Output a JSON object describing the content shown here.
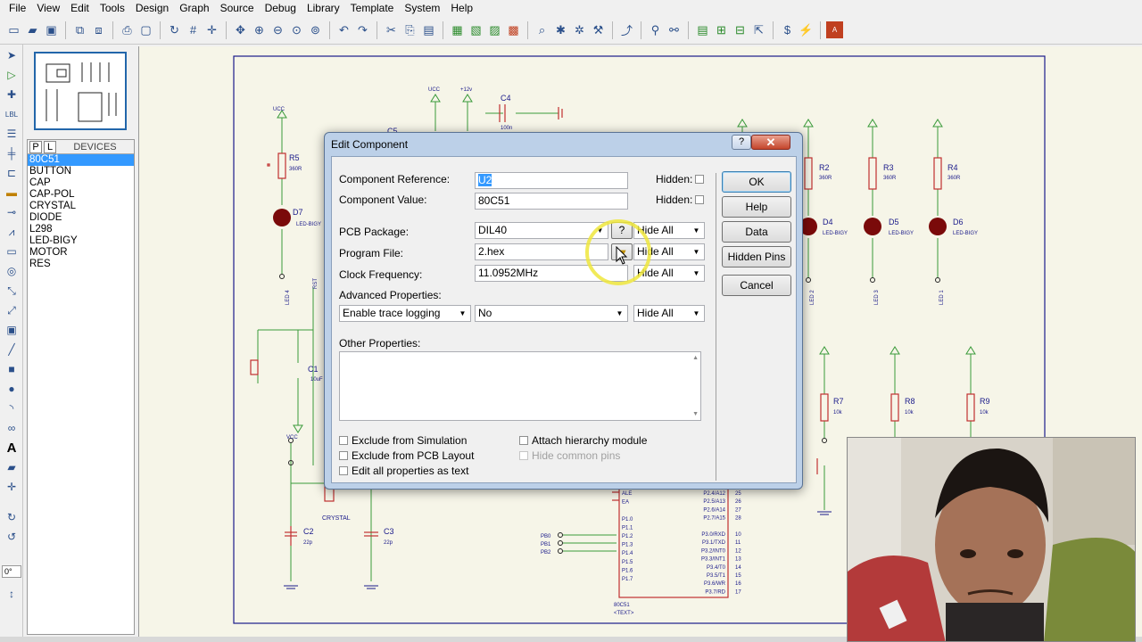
{
  "menu": [
    "File",
    "View",
    "Edit",
    "Tools",
    "Design",
    "Graph",
    "Source",
    "Debug",
    "Library",
    "Template",
    "System",
    "Help"
  ],
  "device_panel": {
    "tab_p": "P",
    "tab_l": "L",
    "title": "DEVICES",
    "items": [
      "80C51",
      "BUTTON",
      "CAP",
      "CAP-POL",
      "CRYSTAL",
      "DIODE",
      "L298",
      "LED-BIGY",
      "MOTOR",
      "RES"
    ],
    "selected": "80C51"
  },
  "rotation": "0°",
  "schematic": {
    "labels": {
      "r5": "R5",
      "r5v": "360R",
      "d7": "D7",
      "d7p": "LED-BIGY",
      "led4": "LED 4",
      "rst": "RST",
      "vcc": "VCC",
      "c1": "C1",
      "c1v": "10uF",
      "c2": "C2",
      "c2v": "22p",
      "c3": "C3",
      "c3v": "22p",
      "crystal": "CRYSTAL",
      "c4": "C4",
      "c4v": "100n",
      "c5": "C5",
      "v12": "+12v",
      "r2": "R2",
      "r3": "R3",
      "r4": "R4",
      "rv": "360R",
      "d4": "D4",
      "d5": "D5",
      "d6": "D6",
      "ledp": "LED-BIGY",
      "led2": "LED 2",
      "led3": "LED 3",
      "led1": "LED 1",
      "r7": "R7",
      "r8": "R8",
      "r9": "R9",
      "rk": "10k",
      "pb0": "PB0",
      "pb1": "PB1",
      "pb2": "PB2",
      "u2": "80C51",
      "text": "<TEXT>",
      "ucc": "UCC",
      "pins_left": [
        "ALE",
        "EA",
        "",
        "P1.0",
        "P1.1",
        "P1.2",
        "P1.3",
        "P1.4",
        "P1.5",
        "P1.6",
        "P1.7"
      ],
      "pins_right": [
        "P2.4/A12",
        "P2.5/A13",
        "P2.6/A14",
        "P2.7/A15",
        "",
        "P3.0/RXD",
        "P3.1/TXD",
        "P3.2/INT0",
        "P3.3/INT1",
        "P3.4/T0",
        "P3.5/T1",
        "P3.6/WR",
        "P3.7/RD"
      ],
      "pin_nums_right": [
        "25",
        "26",
        "27",
        "28",
        "",
        "10",
        "11",
        "12",
        "13",
        "14",
        "15",
        "16",
        "17"
      ]
    }
  },
  "dialog": {
    "title": "Edit Component",
    "help_glyph": "?",
    "close_glyph": "✕",
    "component_reference": {
      "label": "Component Reference:",
      "value": "U2"
    },
    "component_value": {
      "label": "Component Value:",
      "value": "80C51"
    },
    "hidden_label": "Hidden:",
    "pcb_package": {
      "label": "PCB Package:",
      "value": "DIL40",
      "visibility": "Hide All",
      "query": "?"
    },
    "program_file": {
      "label": "Program File:",
      "value": "2.hex",
      "visibility": "Hide All"
    },
    "clock_frequency": {
      "label": "Clock Frequency:",
      "value": "11.0952MHz",
      "visibility": "Hide All"
    },
    "advanced": {
      "label": "Advanced Properties:",
      "property": "Enable trace logging",
      "value": "No",
      "visibility": "Hide All"
    },
    "other_properties_label": "Other Properties:",
    "checks": {
      "exclude_sim": "Exclude from Simulation",
      "exclude_pcb": "Exclude from PCB Layout",
      "edit_text": "Edit all properties as text",
      "attach_hier": "Attach hierarchy module",
      "hide_pins": "Hide common pins"
    },
    "buttons": {
      "ok": "OK",
      "help": "Help",
      "data": "Data",
      "hidden_pins": "Hidden Pins",
      "cancel": "Cancel"
    }
  },
  "colors": {
    "wire": "#3a9a3a",
    "part": "#c03030",
    "text": "#1a1a8a",
    "dialog_border": "#5a7394"
  }
}
